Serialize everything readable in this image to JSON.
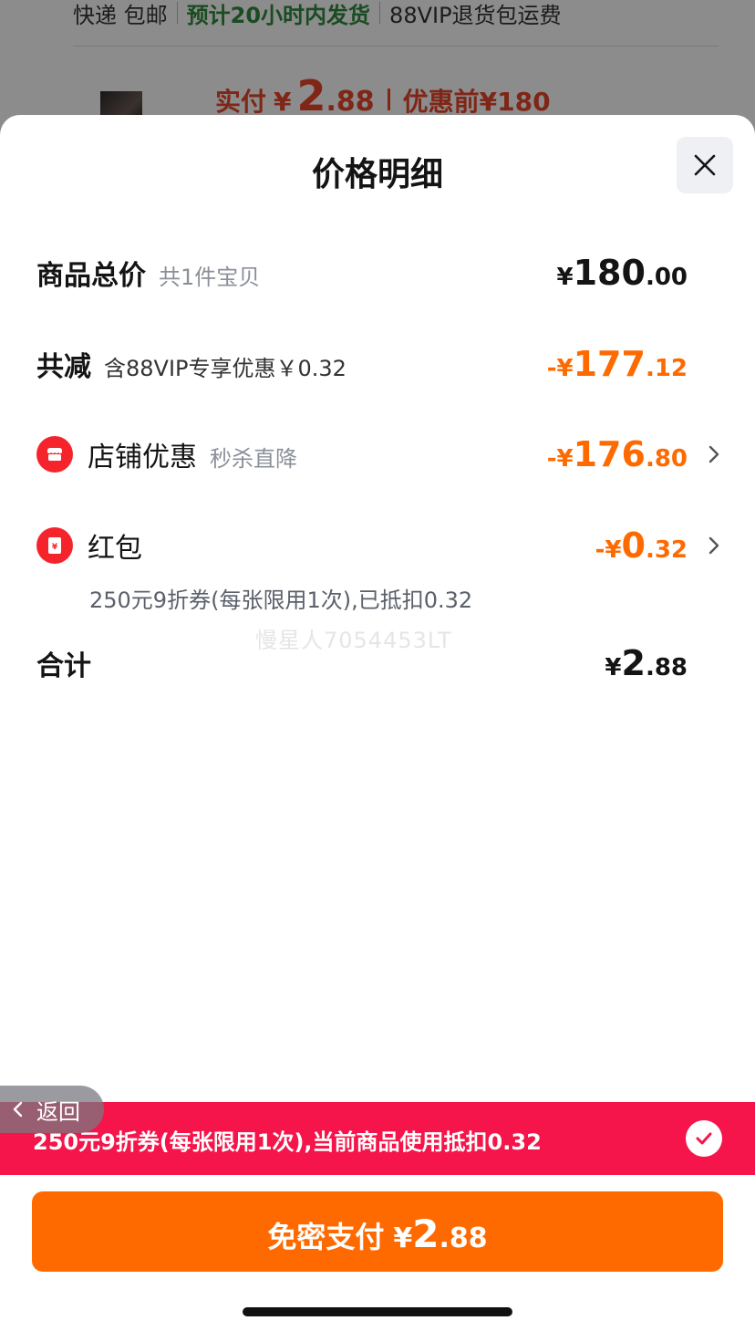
{
  "background": {
    "shipping": {
      "part1": "快递 包邮",
      "part2": "预计20小时内发货",
      "part3": "88VIP退货包运费"
    },
    "price": {
      "label": "实付",
      "currency": "¥",
      "int": "2",
      "dec": ".88",
      "original": "优惠前¥180"
    }
  },
  "sheet": {
    "title": "价格明细",
    "close_icon": "close-icon",
    "rows": {
      "total": {
        "label": "商品总价",
        "sub": "共1件宝贝",
        "currency": "¥",
        "int": "180",
        "dec": ".00"
      },
      "discount": {
        "label": "共减",
        "sub": "含88VIP专享优惠￥0.32",
        "currency": "-¥",
        "int": "177",
        "dec": ".12"
      },
      "store": {
        "label": "店铺优惠",
        "sub": "秒杀直降",
        "currency": "-¥",
        "int": "176",
        "dec": ".80",
        "icon": "store-icon"
      },
      "redpacket": {
        "label": "红包",
        "currency": "-¥",
        "int": "0",
        "dec": ".32",
        "icon": "red-packet-icon",
        "note": "250元9折券(每张限用1次),已抵扣0.32"
      },
      "sum": {
        "label": "合计",
        "currency": "¥",
        "int": "2",
        "dec": ".88"
      }
    },
    "watermark": "慢星人7054453LT"
  },
  "coupon_bar": {
    "text": "250元9折券(每张限用1次),当前商品使用抵扣0.32",
    "checked": true
  },
  "back": {
    "label": "返回"
  },
  "pay_button": {
    "label": "免密支付",
    "currency": "¥",
    "int": "2",
    "dec": ".88"
  },
  "colors": {
    "accent_orange": "#ff6a00",
    "accent_red": "#f5154a",
    "text_primary": "#141414"
  }
}
